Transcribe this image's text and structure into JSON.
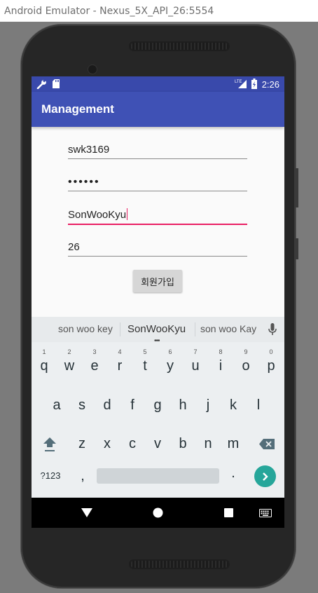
{
  "window": {
    "title": "Android Emulator - Nexus_5X_API_26:5554"
  },
  "status_bar": {
    "time": "2:26",
    "network": "LTE"
  },
  "app_bar": {
    "title": "Management"
  },
  "form": {
    "username": "swk3169",
    "password": "••••••",
    "name": "SonWooKyu",
    "age": "26",
    "submit_label": "회원가입"
  },
  "keyboard": {
    "suggestions": [
      "son woo key",
      "SonWooKyu",
      "son woo Kay"
    ],
    "row1": [
      {
        "letter": "q",
        "num": "1"
      },
      {
        "letter": "w",
        "num": "2"
      },
      {
        "letter": "e",
        "num": "3"
      },
      {
        "letter": "r",
        "num": "4"
      },
      {
        "letter": "t",
        "num": "5"
      },
      {
        "letter": "y",
        "num": "6"
      },
      {
        "letter": "u",
        "num": "7"
      },
      {
        "letter": "i",
        "num": "8"
      },
      {
        "letter": "o",
        "num": "9"
      },
      {
        "letter": "p",
        "num": "0"
      }
    ],
    "row2": [
      "a",
      "s",
      "d",
      "f",
      "g",
      "h",
      "j",
      "k",
      "l"
    ],
    "row3": [
      "z",
      "x",
      "c",
      "v",
      "b",
      "n",
      "m"
    ],
    "symbols_label": "?123",
    "comma": ",",
    "period": "."
  },
  "colors": {
    "status_bar": "#3949ab",
    "app_bar": "#3f51b5",
    "focus_underline": "#e91e63",
    "enter_key": "#26a69a"
  },
  "icons": [
    "wrench-icon",
    "sd-card-icon",
    "signal-icon",
    "battery-icon",
    "microphone-icon",
    "shift-icon",
    "backspace-icon",
    "enter-icon",
    "nav-back-icon",
    "nav-home-icon",
    "nav-recents-icon",
    "keyboard-icon"
  ]
}
